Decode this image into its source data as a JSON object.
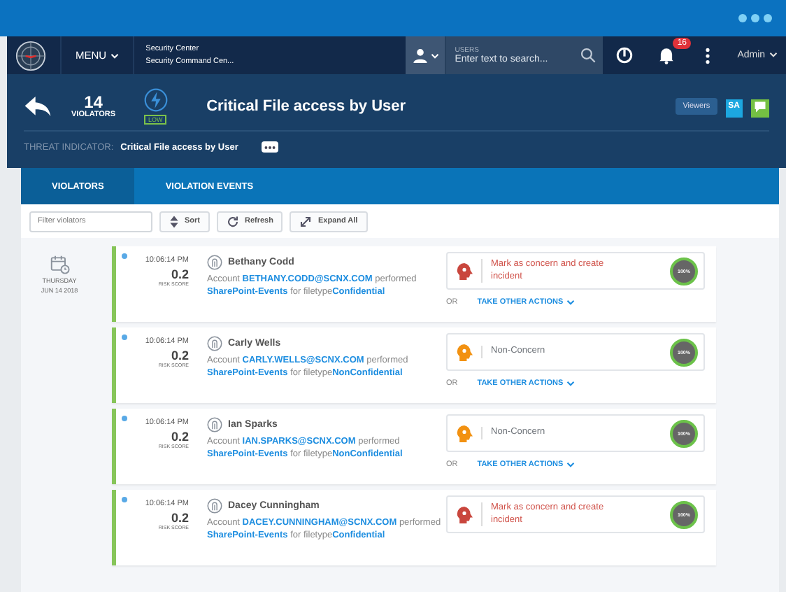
{
  "nav": {
    "menu": "MENU",
    "app_title": "Security Center",
    "app_subtitle": "Security Command Cen...",
    "search": {
      "label": "USERS",
      "placeholder": "Enter text to search..."
    },
    "notifications": "16",
    "user": "Admin"
  },
  "header": {
    "count": "14",
    "count_label": "VIOLATORS",
    "severity": "LOW",
    "title": "Critical File access by User",
    "viewers": "Viewers",
    "avatar": "SA"
  },
  "threat_indicator": {
    "label": "THREAT INDICATOR:",
    "value": "Critical File access by User"
  },
  "tabs": [
    {
      "label": "VIOLATORS",
      "selected": true
    },
    {
      "label": "VIOLATION EVENTS",
      "selected": false
    }
  ],
  "toolbar": {
    "filter_placeholder": "Filter violators",
    "buttons": [
      {
        "kind": "sort",
        "label": "Sort"
      },
      {
        "kind": "refresh",
        "label": "Refresh"
      },
      {
        "kind": "expand",
        "label": "Expand All"
      }
    ]
  },
  "date": {
    "day": "THURSDAY",
    "date": "JUN 14 2018"
  },
  "violations": [
    {
      "time": "10:06:14 PM",
      "score": "0.2",
      "score_label": "RISK SCORE",
      "name": "Bethany Codd",
      "prefix": "Account",
      "email": "BETHANY.CODD@SCNX.COM",
      "verb": "performed",
      "event": "SharePoint-Events",
      "for": "for filetype",
      "filetype": "Confidential",
      "action": {
        "kind": "concern",
        "label": "Mark as concern and create incident"
      },
      "percent": "100%",
      "or": "OR",
      "other": "TAKE OTHER ACTIONS"
    },
    {
      "time": "10:06:14 PM",
      "score": "0.2",
      "score_label": "RISK SCORE",
      "name": "Carly Wells",
      "prefix": "Account",
      "email": "CARLY.WELLS@SCNX.COM",
      "verb": "performed",
      "event": "SharePoint-Events",
      "for": "for filetype",
      "filetype": "NonConfidential",
      "action": {
        "kind": "non-concern",
        "label": "Non-Concern"
      },
      "percent": "100%",
      "or": "OR",
      "other": "TAKE OTHER ACTIONS"
    },
    {
      "time": "10:06:14 PM",
      "score": "0.2",
      "score_label": "RISK SCORE",
      "name": "Ian Sparks",
      "prefix": "Account",
      "email": "IAN.SPARKS@SCNX.COM",
      "verb": "performed",
      "event": "SharePoint-Events",
      "for": "for filetype",
      "filetype": "NonConfidential",
      "action": {
        "kind": "non-concern",
        "label": "Non-Concern"
      },
      "percent": "100%",
      "or": "OR",
      "other": "TAKE OTHER ACTIONS"
    },
    {
      "time": "10:06:14 PM",
      "score": "0.2",
      "score_label": "RISK SCORE",
      "name": "Dacey Cunningham",
      "prefix": "Account",
      "email": "DACEY.CUNNINGHAM@SCNX.COM",
      "verb": "performed",
      "event": "SharePoint-Events",
      "for": "for filetype",
      "filetype": "Confidential",
      "action": {
        "kind": "concern",
        "label": "Mark as concern and create incident"
      },
      "percent": "100%"
    }
  ]
}
